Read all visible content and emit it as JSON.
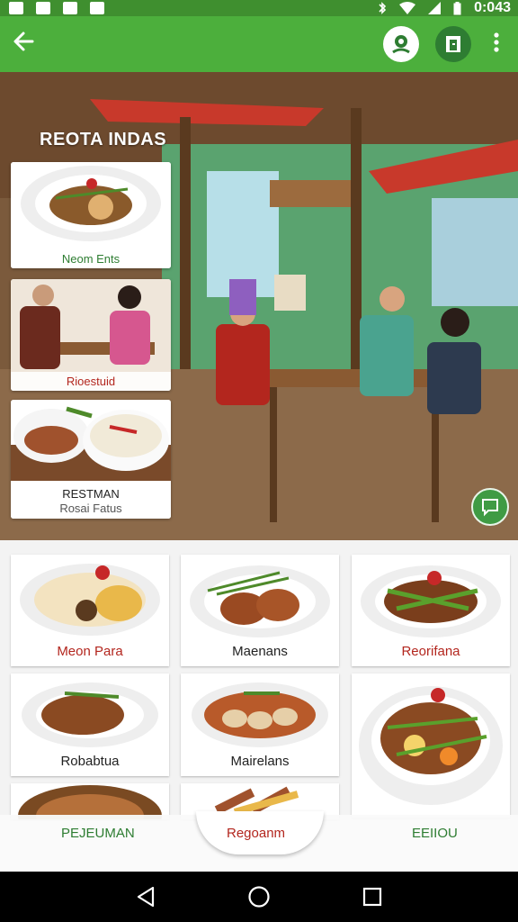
{
  "status_bar": {
    "time": "0:043"
  },
  "header": {
    "back_icon": "arrow-left-icon",
    "action1_icon": "location-pin-icon",
    "action2_icon": "door-exit-icon",
    "more_icon": "more-vertical-icon"
  },
  "hero": {
    "title": "REOTA INDAS",
    "cards": [
      {
        "label": "Neom Ents"
      },
      {
        "label": "Rioestuid"
      },
      {
        "label": "RESTMAN",
        "sublabel": "Rosai Fatus"
      }
    ],
    "fab_icon": "chat-bubble-icon"
  },
  "dishes": [
    {
      "label": "Meon Para"
    },
    {
      "label": "Maenans"
    },
    {
      "label": "Reorifana"
    },
    {
      "label": "Robabtua"
    },
    {
      "label": "Mairelans"
    }
  ],
  "bottom_row": [
    {
      "label": "PEJEUMAN"
    },
    {
      "label": "Regoanm"
    },
    {
      "label": "EEIIOU"
    }
  ],
  "colors": {
    "primary": "#4caf3c",
    "status": "#3f8f2f",
    "label_red": "#b3261e",
    "label_green": "#2e7d32"
  },
  "nav": {
    "back_icon": "triangle-back-icon",
    "home_icon": "circle-home-icon",
    "recent_icon": "square-recent-icon"
  }
}
